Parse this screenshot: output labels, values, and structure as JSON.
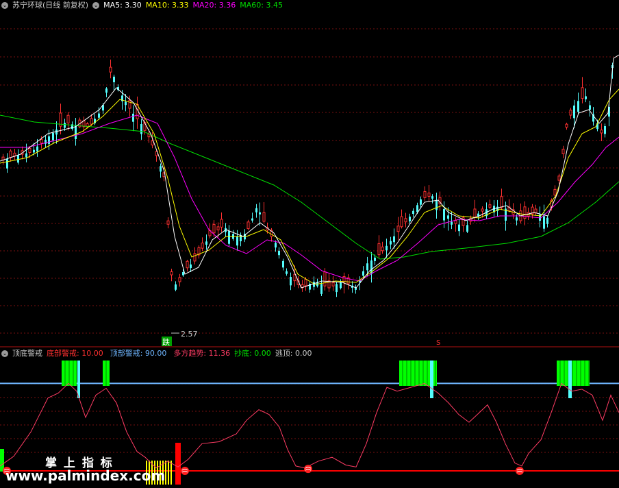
{
  "header_top": {
    "stock": "苏宁环球",
    "period": "(日线 前复权)",
    "ma5": "MA5: 3.30",
    "ma10": "MA10: 3.33",
    "ma20": "MA20: 3.36",
    "ma60": "MA60: 3.45"
  },
  "header_bottom": {
    "name": "顶底警戒",
    "bottom_warn": "底部警戒: 10.00",
    "top_warn": "顶部警戒: 90.00",
    "trend": "多方趋势: 11.36",
    "buy_bottom": "抄底: 0.00",
    "escape_top": "逃顶: 0.00"
  },
  "annotations": {
    "low_price": "2.57",
    "fall_marker": "跌",
    "s_marker": "S"
  },
  "watermark": {
    "cn": "掌 上 指 标",
    "url": "www.palmindex.com"
  },
  "colors": {
    "background": "#000000",
    "up": "#ff3030",
    "down": "#54fcfc",
    "ma5": "#ffffff",
    "ma10": "#ffff00",
    "ma20": "#ff00ff",
    "ma60": "#00e000",
    "osc": "#ff3c64",
    "top_line": "#6fb6ff",
    "bottom_line": "#ff0000",
    "top_bar": "#00ff00"
  },
  "chart_data": [
    {
      "type": "candlestick",
      "title": "苏宁环球 (日线 前复权)",
      "series": [
        {
          "name": "MA5",
          "value": 3.3
        },
        {
          "name": "MA10",
          "value": 3.33
        },
        {
          "name": "MA20",
          "value": 3.36
        },
        {
          "name": "MA60",
          "value": 3.45
        }
      ],
      "low_label": 2.57,
      "grid": true
    },
    {
      "type": "line",
      "title": "顶底警戒",
      "ylim": [
        0,
        100
      ],
      "series": [
        {
          "name": "底部警戒",
          "value": 10.0
        },
        {
          "name": "顶部警戒",
          "value": 90.0
        },
        {
          "name": "多方趋势",
          "value": 11.36
        },
        {
          "name": "抄底",
          "value": 0.0
        },
        {
          "name": "逃顶",
          "value": 0.0
        }
      ],
      "grid": true
    }
  ]
}
